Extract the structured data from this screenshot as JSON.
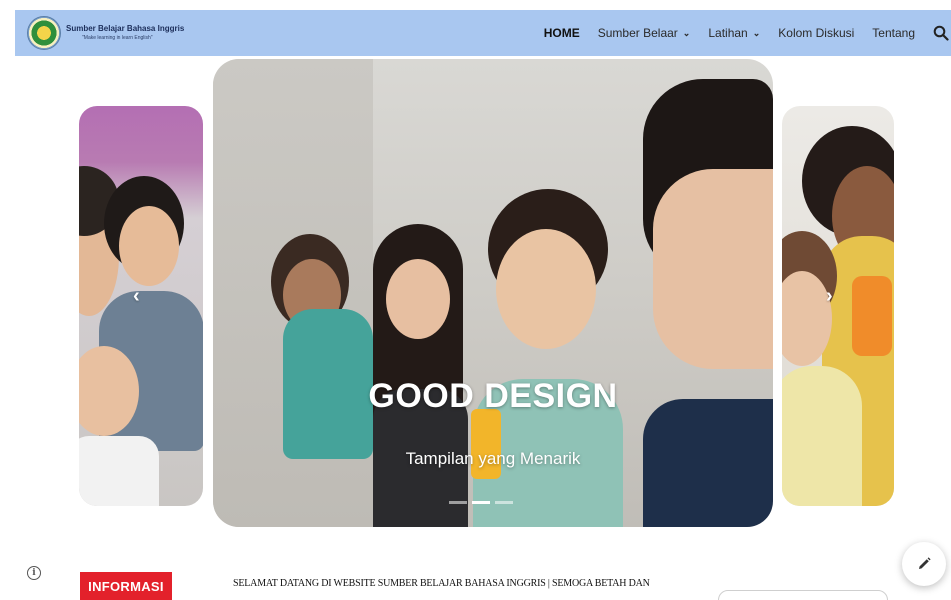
{
  "header": {
    "logo_title": "Sumber Belajar Bahasa Inggris",
    "logo_subtitle": "\"Make learning in learn English\""
  },
  "nav": {
    "items": [
      {
        "label": "HOME",
        "active": true,
        "dropdown": false
      },
      {
        "label": "Sumber Belaar",
        "active": false,
        "dropdown": true
      },
      {
        "label": "Latihan",
        "active": false,
        "dropdown": true
      },
      {
        "label": "Kolom Diskusi",
        "active": false,
        "dropdown": false
      },
      {
        "label": "Tentang",
        "active": false,
        "dropdown": false
      }
    ],
    "search_icon": "search-icon"
  },
  "carousel": {
    "title": "GOOD DESIGN",
    "subtitle": "Tampilan yang Menarik",
    "slide_count": 3,
    "active_slide": 1,
    "prev_icon": "‹",
    "next_icon": "›"
  },
  "info": {
    "badge": "INFORMASI",
    "ticker": "SELAMAT DATANG DI WEBSITE SUMBER BELAJAR BAHASA INGGRIS | SEMOGA BETAH DAN"
  },
  "colors": {
    "header_bg": "#a9c7f0",
    "badge_bg": "#e3212b"
  }
}
